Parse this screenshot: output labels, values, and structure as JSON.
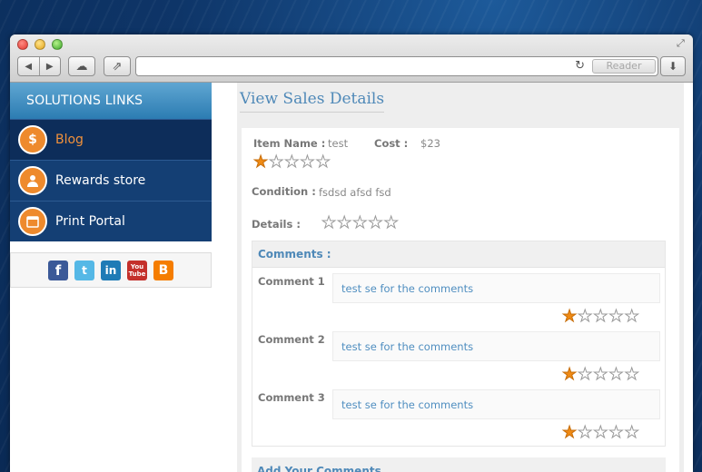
{
  "browser": {
    "reader_label": "Reader",
    "address_value": ""
  },
  "sidebar": {
    "header": "SOLUTIONS LINKS",
    "items": [
      {
        "label": "Blog",
        "icon": "dollar-icon",
        "active": true
      },
      {
        "label": "Rewards store",
        "icon": "user-icon",
        "active": false
      },
      {
        "label": "Print Portal",
        "icon": "calendar-icon",
        "active": false
      }
    ],
    "social": [
      "facebook-icon",
      "twitter-icon",
      "linkedin-icon",
      "youtube-icon",
      "blogger-icon"
    ]
  },
  "main": {
    "title": "View Sales Details",
    "item_name_label": "Item Name :",
    "item_name_value": "test",
    "cost_label": "Cost :",
    "cost_value": "$23",
    "item_rating": 1,
    "condition_label": "Condition :",
    "condition_value": "fsdsd afsd fsd",
    "details_label": "Details :",
    "details_rating": 0,
    "comments_title": "Comments :",
    "comments": [
      {
        "label": "Comment 1",
        "text": "test se for the comments",
        "rating": 1
      },
      {
        "label": "Comment 2",
        "text": "test se for the comments",
        "rating": 1
      },
      {
        "label": "Comment 3",
        "text": "test se for the comments",
        "rating": 1
      }
    ],
    "add_comments_title": "Add Your Comments"
  },
  "colors": {
    "accent": "#4f89b8",
    "orange": "#f08a14",
    "sidebar_bg": "#143f74"
  }
}
